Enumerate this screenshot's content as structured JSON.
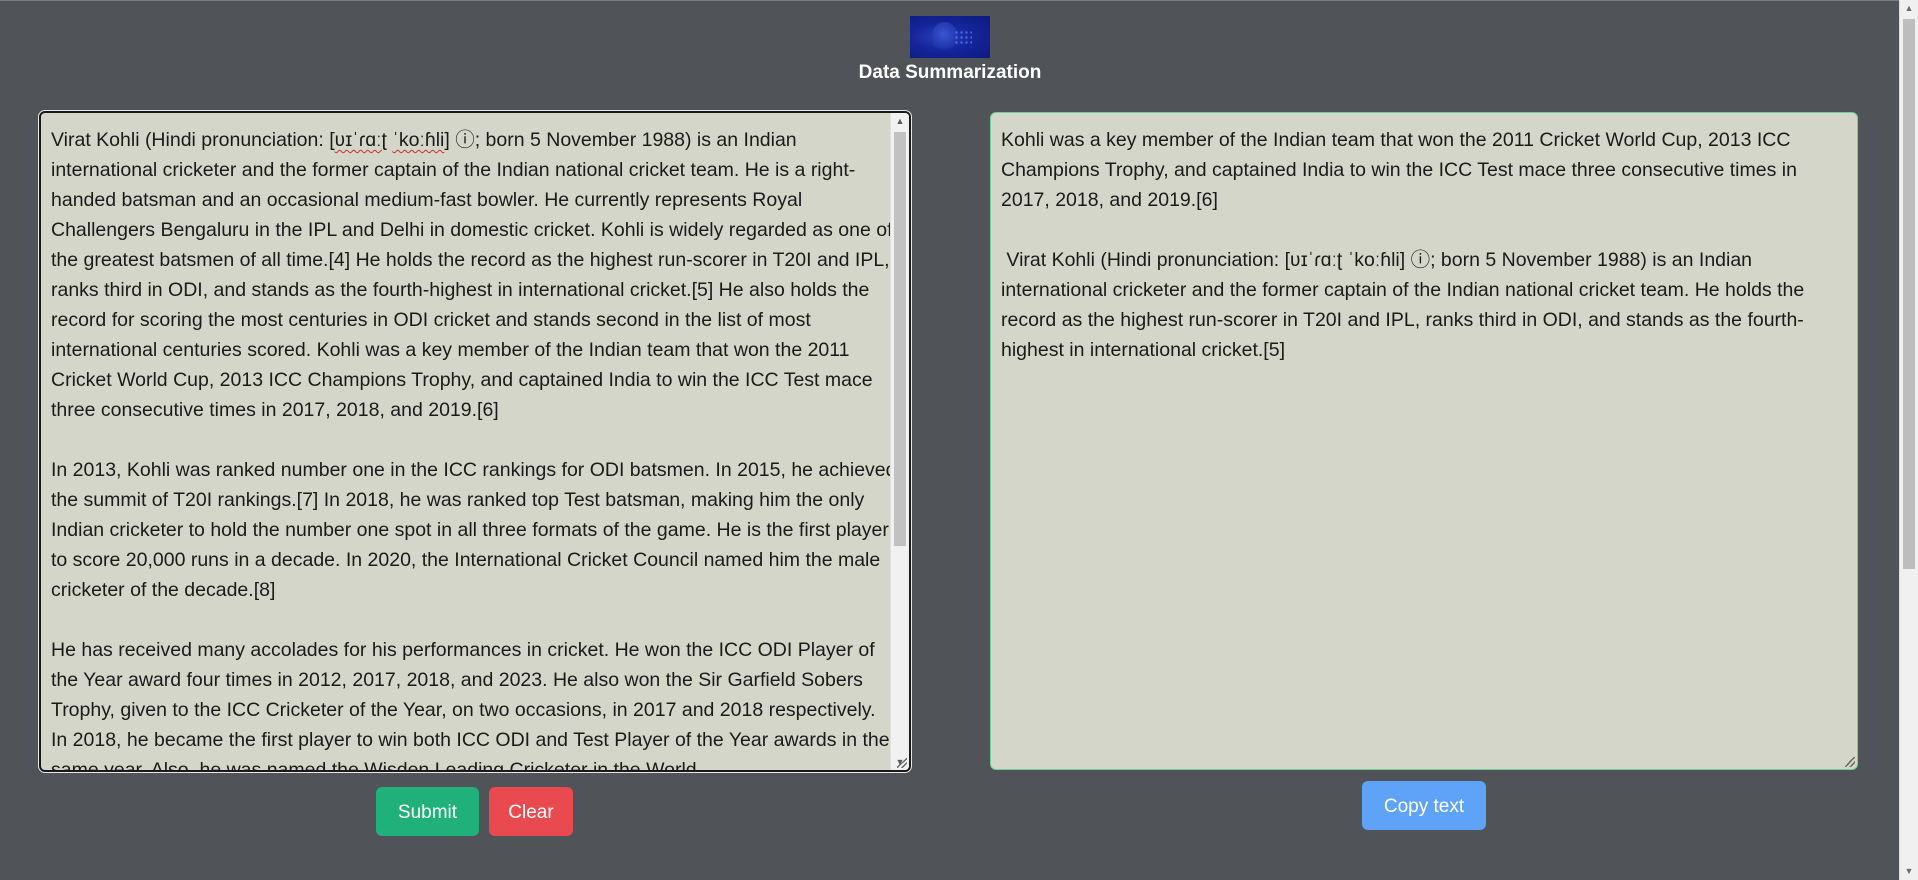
{
  "header": {
    "logo_name": "brain-logo",
    "title": "Data Summarization"
  },
  "input": {
    "line1_pre": "Virat Kohli (Hindi pronunciation: [",
    "line1_ipa1": "ʋɪˈɾɑːʈ",
    "line1_space": " ",
    "line1_ipa2": "ˈkoːɦli",
    "line1_post": "] ⓘ; born 5 November 1988) is an Indian international cricketer and the former captain of the Indian national cricket team. He is a right-handed batsman and an occasional medium-fast bowler. He currently represents Royal Challengers Bengaluru in the IPL and Delhi in domestic cricket. Kohli is widely regarded as one of the greatest batsmen of all time.[4] He holds the record as the highest run-scorer in T20I and IPL, ranks third in ODI, and stands as the fourth-highest in international cricket.[5] He also holds the record for scoring the most centuries in ODI cricket and stands second in the list of most international centuries scored. Kohli was a key member of the Indian team that won the 2011 Cricket World Cup, 2013 ICC Champions Trophy, and captained India to win the ICC Test mace three consecutive times in 2017, 2018, and 2019.[6]",
    "para2": "In 2013, Kohli was ranked number one in the ICC rankings for ODI batsmen. In 2015, he achieved the summit of T20I rankings.[7] In 2018, he was ranked top Test batsman, making him the only Indian cricketer to hold the number one spot in all three formats of the game. He is the first player to score 20,000 runs in a decade. In 2020, the International Cricket Council named him the male cricketer of the decade.[8]",
    "para3": "He has received many accolades for his performances in cricket. He won the ICC ODI Player of the Year award four times in 2012, 2017, 2018, and 2023. He also won the Sir Garfield Sobers Trophy, given to the ICC Cricketer of the Year, on two occasions, in 2017 and 2018 respectively. In 2018, he became the first player to win both ICC ODI and Test Player of the Year awards in the same year. Also, he was named the Wisden Leading Cricketer in the World"
  },
  "output": {
    "para1": "Kohli was a key member of the Indian team that won the 2011 Cricket World Cup, 2013 ICC Champions Trophy, and captained India to win the ICC Test mace three consecutive times in 2017, 2018, and 2019.[6]",
    "para2": " Virat Kohli (Hindi pronunciation: [ʋɪˈɾɑːʈ ˈkoːɦli] ⓘ; born 5 November 1988) is an Indian international cricketer and the former captain of the Indian national cricket team. He holds the record as the highest run-scorer in T20I and IPL, ranks third in ODI, and stands as the fourth-highest in international cricket.[5]"
  },
  "buttons": {
    "submit": "Submit",
    "clear": "Clear",
    "copy": "Copy text"
  },
  "colors": {
    "background": "#505357",
    "panel": "#d4d6ca",
    "submit": "#1fb179",
    "clear": "#e84a4f",
    "copy": "#5ea3f7",
    "output_border": "#6fd19a"
  }
}
